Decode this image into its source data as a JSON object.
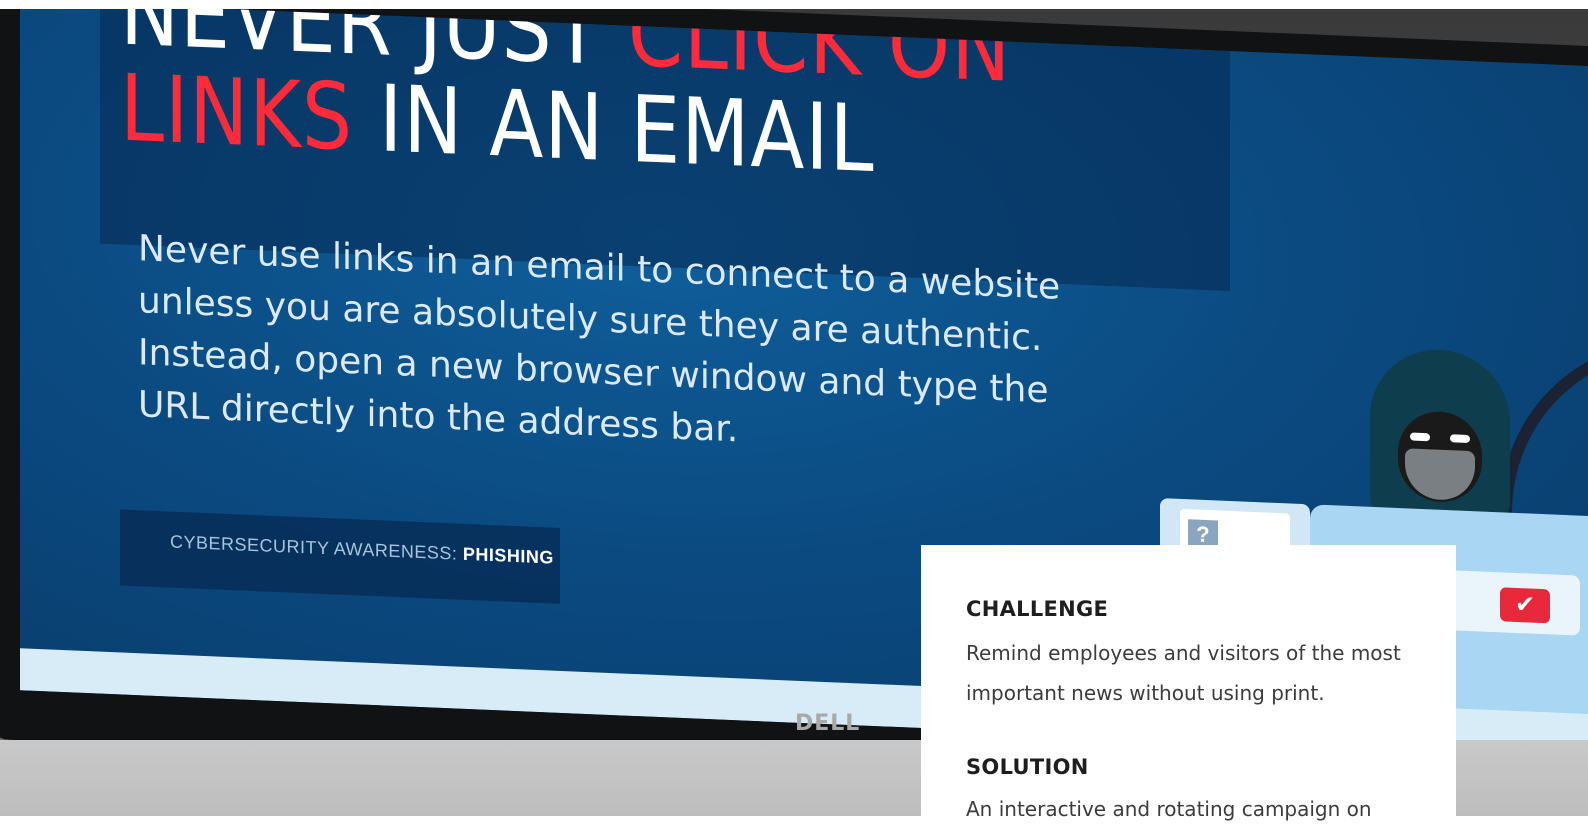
{
  "hero": {
    "headline_line1_white": "NEVER JUST",
    "headline_line1_red": "CLICK ON",
    "headline_line2_red": "LINKS",
    "headline_line2_white": "IN AN EMAIL",
    "body_text": "Never use links in an email to connect to a website unless you are absolutely sure they are authentic. Instead, open a new browser window and type the URL directly into the address bar.",
    "tag_prefix": "CYBERSECURITY AWARENESS:",
    "tag_highlight": "PHISHING",
    "monitor_brand": "DELL"
  },
  "card": {
    "challenge_heading": "CHALLENGE",
    "challenge_text": "Remind employees and visitors of the most important news without using print.",
    "solution_heading": "SOLUTION",
    "solution_text": "An interactive and rotating campaign on"
  },
  "colors": {
    "screen_blue": "#0b4b82",
    "accent_red": "#ff2b3a",
    "card_bg": "#ffffff",
    "heading_text": "#1e1e1e"
  },
  "icons": {
    "check": "check-icon",
    "question": "question-icon"
  }
}
